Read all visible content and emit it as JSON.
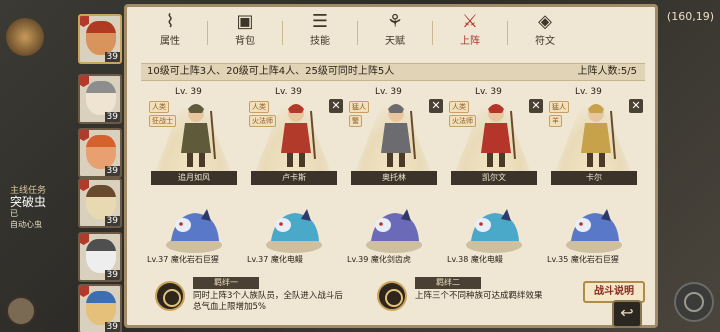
{
  "status": {
    "coords": "(160,19)"
  },
  "quest": {
    "title": "主线任务",
    "name": "突破虫",
    "line1": "已",
    "line2": "自动心虫"
  },
  "roster": [
    {
      "level": "39",
      "face": "#d9945e",
      "hair": "#b03a22"
    },
    {
      "level": "39",
      "face": "#efe3d2",
      "hair": "#8d8d8d"
    },
    {
      "level": "39",
      "face": "#e8a070",
      "hair": "#d5622e"
    },
    {
      "level": "39",
      "face": "#e9d9b2",
      "hair": "#6a4a2c"
    },
    {
      "level": "39",
      "face": "#eeeeee",
      "hair": "#4f4f4f"
    },
    {
      "level": "39",
      "face": "#e4c07a",
      "hair": "#3b6fb0"
    }
  ],
  "tabs": [
    {
      "label": "属性",
      "glyph": "⌇",
      "icon": "flame-icon"
    },
    {
      "label": "背包",
      "glyph": "▣",
      "icon": "backpack-icon"
    },
    {
      "label": "技能",
      "glyph": "☰",
      "icon": "book-icon"
    },
    {
      "label": "天赋",
      "glyph": "⚘",
      "icon": "talent-icon"
    },
    {
      "label": "上阵",
      "glyph": "⚔",
      "icon": "crossed-swords-icon"
    },
    {
      "label": "符文",
      "glyph": "◈",
      "icon": "rune-icon"
    }
  ],
  "info": {
    "rule": "10级可上阵3人、20级可上阵4人、25级可同时上阵5人",
    "count": "上阵人数:5/5"
  },
  "cards": [
    {
      "level": "Lv. 39",
      "badge1": "人类",
      "badge2": "狂战士",
      "name": "追月如风",
      "closable": false,
      "color": "#5e5a3a",
      "pet": "Lv.37 魔化岩石巨猩",
      "pet_color": "#5a78c8"
    },
    {
      "level": "Lv. 39",
      "badge1": "人类",
      "badge2": "火法师",
      "name": "卢卡斯",
      "closable": true,
      "color": "#b13a2a",
      "pet": "Lv.37 魔化电鳗",
      "pet_color": "#4aa8c8"
    },
    {
      "level": "Lv. 39",
      "badge1": "猛人",
      "badge2": "警",
      "name": "奥托林",
      "closable": true,
      "color": "#6b6b70",
      "pet": "Lv.39 魔化剑齿虎",
      "pet_color": "#6a6ab8"
    },
    {
      "level": "Lv. 39",
      "badge1": "人类",
      "badge2": "火法师",
      "name": "凯尔文",
      "closable": true,
      "color": "#b5352a",
      "pet": "Lv.38 魔化电鳗",
      "pet_color": "#4aa8c8"
    },
    {
      "level": "Lv. 39",
      "badge1": "猛人",
      "badge2": "羊",
      "name": "卡尔",
      "closable": true,
      "color": "#c7a24a",
      "pet": "Lv.35 魔化岩石巨猩",
      "pet_color": "#5a78c8"
    }
  ],
  "bonds": [
    {
      "title": "羁绊一",
      "line1": "同时上阵3个人族队员，全队进入战斗后",
      "line2": "总气血上限增加5%"
    },
    {
      "title": "羁绊二",
      "line1": "上阵三个不同种族可达成羁绊效果",
      "line2": ""
    }
  ],
  "buttons": {
    "battle_help": "战斗说明",
    "back": "↩"
  },
  "colors": {
    "panel": "#efe6d3",
    "accent_red": "#b0362a",
    "border_gold": "#a08b66"
  }
}
